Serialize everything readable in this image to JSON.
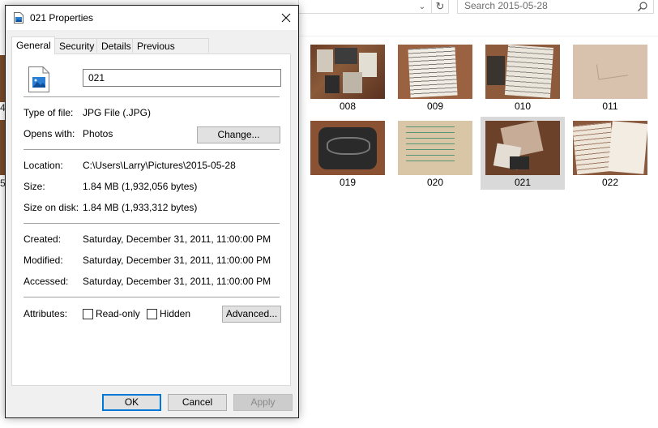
{
  "explorer": {
    "search_placeholder": "Search 2015-05-28",
    "partial_labels": [
      "4",
      "5"
    ],
    "thumbnails": [
      {
        "name": "008",
        "selected": false
      },
      {
        "name": "009",
        "selected": false
      },
      {
        "name": "010",
        "selected": false
      },
      {
        "name": "011",
        "selected": false
      },
      {
        "name": "019",
        "selected": false
      },
      {
        "name": "020",
        "selected": false
      },
      {
        "name": "021",
        "selected": true
      },
      {
        "name": "022",
        "selected": false
      }
    ]
  },
  "dialog": {
    "title": "021 Properties",
    "tabs": [
      "General",
      "Security",
      "Details",
      "Previous Versions"
    ],
    "active_tab": "General",
    "file_name": "021",
    "type_label": "Type of file:",
    "type_value": "JPG File (.JPG)",
    "opens_label": "Opens with:",
    "opens_value": "Photos",
    "change_button": "Change...",
    "location_label": "Location:",
    "location_value": "C:\\Users\\Larry\\Pictures\\2015-05-28",
    "size_label": "Size:",
    "size_value": "1.84 MB (1,932,056 bytes)",
    "disk_label": "Size on disk:",
    "disk_value": "1.84 MB (1,933,312 bytes)",
    "created_label": "Created:",
    "created_value": "Saturday, December 31, 2011, 11:00:00 PM",
    "modified_label": "Modified:",
    "modified_value": "Saturday, December 31, 2011, 11:00:00 PM",
    "accessed_label": "Accessed:",
    "accessed_value": "Saturday, December 31, 2011, 11:00:00 PM",
    "attributes_label": "Attributes:",
    "readonly_label": "Read-only",
    "readonly_checked": false,
    "hidden_label": "Hidden",
    "hidden_checked": false,
    "advanced_button": "Advanced...",
    "ok_button": "OK",
    "cancel_button": "Cancel",
    "apply_button": "Apply",
    "apply_enabled": false
  },
  "icons": {
    "title": "image-file-icon",
    "close": "close-icon",
    "file": "jpg-file-icon",
    "search": "search-icon",
    "refresh": "refresh-icon",
    "dropdown": "chevron-down-icon"
  },
  "colors": {
    "accent": "#0078d7",
    "selection": "#d9d9d9",
    "dialog_bg": "#f0f0f0"
  }
}
